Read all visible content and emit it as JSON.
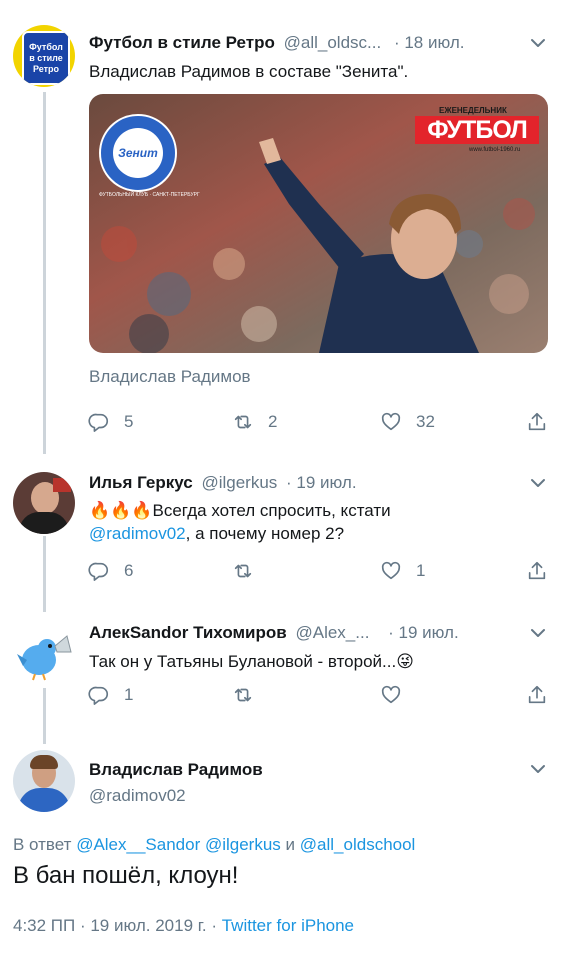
{
  "tweets": [
    {
      "name": "Футбол в стиле Ретро",
      "handle": "@all_oldsc...",
      "date": "· 18 июл.",
      "text": "Владислав Радимов в составе \"Зенита\".",
      "avatar_text": [
        "Футбол",
        "в стиле",
        "Ретро"
      ],
      "media": {
        "magazine_header": "ЕЖЕНЕДЕЛЬНИК",
        "magazine_title": "ФУТБОЛ",
        "magazine_url": "www.futbol-1960.ru",
        "club_logo_text": "Зенит",
        "club_logo_ring": "ФУТБОЛЬНЫЙ КЛУБ · САНКТ-ПЕТЕРБУРГ"
      },
      "caption": "Владислав Радимов",
      "reply_count": "5",
      "retweet_count": "2",
      "like_count": "32"
    },
    {
      "name": "Илья Геркус",
      "handle": "@ilgerkus",
      "date": "· 19 июл.",
      "emoji": "🔥🔥🔥",
      "text_1": "Всегда хотел спросить, кстати",
      "mention": "@radimov02",
      "text_2": ", а почему номер 2?",
      "reply_count": "6",
      "retweet_count": "",
      "like_count": "1"
    },
    {
      "name": "АлекSandor Тихомиров",
      "handle": "@Alex_...",
      "date": "· 19 июл.",
      "text": "Так он у Татьяны Булановой - второй...",
      "emoji": "😜",
      "reply_count": "1",
      "retweet_count": "",
      "like_count": ""
    }
  ],
  "main_tweet": {
    "name": "Владислав Радимов",
    "handle": "@radimov02",
    "reply_prefix": "В ответ",
    "reply_to": "@Alex__Sandor @ilgerkus",
    "reply_and": "и",
    "reply_to_last": "@all_oldschool",
    "text": "В бан пошёл, клоун!",
    "time": "4:32 ПП · 19 июл. 2019 г. ·",
    "source": "Twitter for iPhone"
  },
  "colors": {
    "link": "#1b95e0",
    "secondary": "#657786",
    "thread_line": "#cdd4da"
  }
}
